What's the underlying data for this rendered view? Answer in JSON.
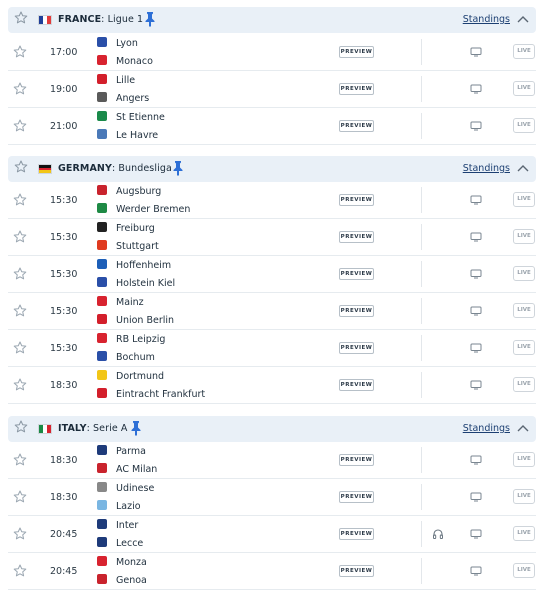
{
  "leagues": [
    {
      "country": "FRANCE",
      "name": "Ligue 1",
      "flag": [
        "#1f3f99",
        "#ffffff",
        "#e23b3b"
      ],
      "standings_label": "Standings",
      "matches": [
        {
          "time": "17:00",
          "home": "Lyon",
          "away": "Monaco",
          "home_color": "#2a4fa8",
          "away_color": "#d8232f",
          "preview_label": "PREVIEW",
          "live_label": "LIVE",
          "audio": false
        },
        {
          "time": "19:00",
          "home": "Lille",
          "away": "Angers",
          "home_color": "#d31f2b",
          "away_color": "#5a5a5a",
          "preview_label": "PREVIEW",
          "live_label": "LIVE",
          "audio": false
        },
        {
          "time": "21:00",
          "home": "St Etienne",
          "away": "Le Havre",
          "home_color": "#1a8a4a",
          "away_color": "#4a79b8",
          "preview_label": "PREVIEW",
          "live_label": "LIVE",
          "audio": false
        }
      ]
    },
    {
      "country": "GERMANY",
      "name": "Bundesliga",
      "flag": [
        "#111111",
        "#d8232f",
        "#f2c617"
      ],
      "flag_horizontal": true,
      "standings_label": "Standings",
      "matches": [
        {
          "time": "15:30",
          "home": "Augsburg",
          "away": "Werder Bremen",
          "home_color": "#c9232d",
          "away_color": "#1e8a45",
          "preview_label": "PREVIEW",
          "live_label": "LIVE",
          "audio": false
        },
        {
          "time": "15:30",
          "home": "Freiburg",
          "away": "Stuttgart",
          "home_color": "#222222",
          "away_color": "#e03a1f",
          "preview_label": "PREVIEW",
          "live_label": "LIVE",
          "audio": false
        },
        {
          "time": "15:30",
          "home": "Hoffenheim",
          "away": "Holstein Kiel",
          "home_color": "#1d5fb8",
          "away_color": "#2a4fa8",
          "preview_label": "PREVIEW",
          "live_label": "LIVE",
          "audio": false
        },
        {
          "time": "15:30",
          "home": "Mainz",
          "away": "Union Berlin",
          "home_color": "#d8232f",
          "away_color": "#d31f2b",
          "preview_label": "PREVIEW",
          "live_label": "LIVE",
          "audio": false
        },
        {
          "time": "15:30",
          "home": "RB Leipzig",
          "away": "Bochum",
          "home_color": "#d8232f",
          "away_color": "#2a4fa8",
          "preview_label": "PREVIEW",
          "live_label": "LIVE",
          "audio": false
        },
        {
          "time": "18:30",
          "home": "Dortmund",
          "away": "Eintracht Frankfurt",
          "home_color": "#f2c617",
          "away_color": "#d31f2b",
          "preview_label": "PREVIEW",
          "live_label": "LIVE",
          "audio": false
        }
      ]
    },
    {
      "country": "ITALY",
      "name": "Serie A",
      "flag": [
        "#1a8a45",
        "#ffffff",
        "#d8232f"
      ],
      "standings_label": "Standings",
      "matches": [
        {
          "time": "18:30",
          "home": "Parma",
          "away": "AC Milan",
          "home_color": "#1e3b7a",
          "away_color": "#c9232d",
          "preview_label": "PREVIEW",
          "live_label": "LIVE",
          "audio": false
        },
        {
          "time": "18:30",
          "home": "Udinese",
          "away": "Lazio",
          "home_color": "#888888",
          "away_color": "#7ab6e2",
          "preview_label": "PREVIEW",
          "live_label": "LIVE",
          "audio": false
        },
        {
          "time": "20:45",
          "home": "Inter",
          "away": "Lecce",
          "home_color": "#1e3b7a",
          "away_color": "#1e3b7a",
          "preview_label": "PREVIEW",
          "live_label": "LIVE",
          "audio": true
        },
        {
          "time": "20:45",
          "home": "Monza",
          "away": "Genoa",
          "home_color": "#d8232f",
          "away_color": "#c9232d",
          "preview_label": "PREVIEW",
          "live_label": "LIVE",
          "audio": false
        }
      ]
    }
  ]
}
